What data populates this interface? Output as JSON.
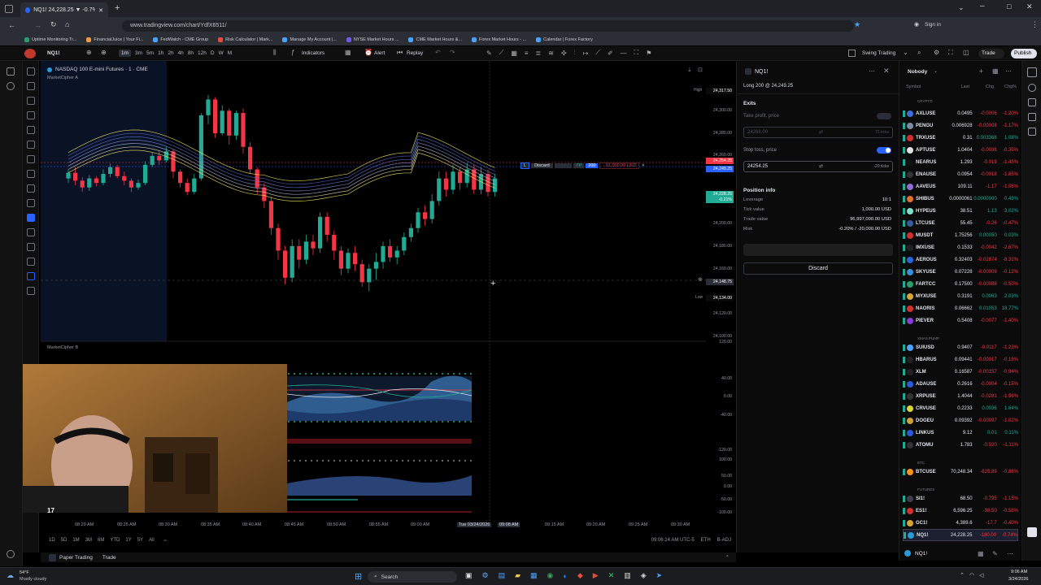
{
  "browser": {
    "tab_title": "NQ1! 24,228.25 ▼ -0.7% Swing...",
    "url": "www.tradingview.com/chart/YdfX6511/",
    "bookmarks": [
      "Uptime Monitoring Tr...",
      "FinancialJuice | Your Fi...",
      "FedWatch - CME Group",
      "Risk Calculator | Mark...",
      "Manage My Account |...",
      "NYSE Market Hours ...",
      "CME Market Hours &...",
      "Forex Market Hours - ...",
      "Calendar | Forex Factory"
    ],
    "sign_in": "Sign in"
  },
  "toolbar": {
    "symbol": "NQ1!",
    "timeframes": [
      "1m",
      "3m",
      "5m",
      "1h",
      "2h",
      "4h",
      "8h",
      "12h",
      "D",
      "W",
      "M"
    ],
    "indicators": "Indicators",
    "alert": "Alert",
    "replay": "Replay",
    "layout_name": "Swing Trading",
    "trade": "Trade",
    "publish": "Publish"
  },
  "chart": {
    "title": "NASDAQ 100 E-mini Futures · 1 · CME",
    "indicator_a": "MarketCipher A",
    "indicator_b": "MarketCipher B",
    "price_labels": [
      "24,317.50",
      "24,300.00",
      "24,280.00",
      "24,260.00",
      "24,254.25",
      "24,249.25",
      "24,228.25",
      "-0.21%",
      "24,200.00",
      "24,180.00",
      "24,160.00",
      "24,148.75",
      "24,134.00",
      "24,120.00",
      "24,100.00"
    ],
    "high_label": "High",
    "low_label": "Low",
    "order_discard": "Discard",
    "order_qty": "200",
    "order_tp": "TP",
    "order_sl_text": "- 91,000.00 USD",
    "osc_labels": [
      "120.00",
      "40.00",
      "0.00",
      "-40.00",
      "-120.00",
      "100.00",
      "50.00",
      "0.00",
      "-50.00",
      "-100.00"
    ],
    "time_labels": [
      "08:20 AM",
      "08:25 AM",
      "08:30 AM",
      "08:35 AM",
      "08:40 AM",
      "08:45 AM",
      "08:50 AM",
      "08:55 AM",
      "09:00 AM",
      "Tue 03/24/2026",
      "09:08 AM",
      "09:15 AM",
      "09:20 AM",
      "09:25 AM",
      "09:30 AM"
    ],
    "ranges": [
      "1D",
      "5D",
      "1M",
      "3M",
      "6M",
      "YTD",
      "1Y",
      "5Y",
      "All"
    ],
    "clock": "09:06:14 AM UTC-5",
    "session": "ETH",
    "adj": "B-ADJ"
  },
  "bottom_tabs": {
    "paper": "Paper Trading",
    "trade": "Trade"
  },
  "order_panel": {
    "symbol": "NQ1!",
    "position": "Long 200 @ 24,249.25",
    "exits": "Exits",
    "tp_label": "Take profit, price",
    "tp_value": "24268.00",
    "tp_ticks": "75 ticks",
    "sl_label": "Stop loss, price",
    "sl_value": "24254.25",
    "sl_ticks": "-20 ticks",
    "info_title": "Position info",
    "rows": [
      {
        "label": "Leverage",
        "value": "10:1"
      },
      {
        "label": "Tick value",
        "value": "1,000.00 USD"
      },
      {
        "label": "Trade value",
        "value": "96,997,000.00 USD"
      },
      {
        "label": "Risk",
        "value": "-0.20% / -20,000.00 USD"
      }
    ],
    "discard": "Discard"
  },
  "watchlist": {
    "title": "Nobody",
    "headers": {
      "symbol": "Symbol",
      "last": "Last",
      "chg": "Chg",
      "pct": "Chg%"
    },
    "sections": [
      "CRYPTO",
      "XMAS PUMP",
      "BTC",
      "FUTURES"
    ],
    "rows": [
      {
        "sym": "AXLUSE",
        "last": "0.0495",
        "chg": "-0.0006",
        "pct": "-1.20%",
        "c": "neg",
        "icon": "#3b6fd6"
      },
      {
        "sym": "PENGU",
        "last": "0.006928",
        "chg": "-0.00008",
        "pct": "-1.17%",
        "c": "neg",
        "icon": "#7a8ba3"
      },
      {
        "sym": "TRXUSE",
        "last": "0.31",
        "chg": "0.003366",
        "pct": "1.08%",
        "c": "pos",
        "icon": "#d23030"
      },
      {
        "sym": "APTUSE",
        "last": "1.0404",
        "chg": "-0.0036",
        "pct": "-0.35%",
        "c": "neg",
        "icon": "#e0e0e0"
      },
      {
        "sym": "NEARUS",
        "last": "1.293",
        "chg": "-0.019",
        "pct": "-1.45%",
        "c": "neg",
        "icon": "#111"
      },
      {
        "sym": "ENAUSE",
        "last": "0.0954",
        "chg": "-0.0018",
        "pct": "-1.85%",
        "c": "neg",
        "icon": "#333"
      },
      {
        "sym": "AAVEUS",
        "last": "109.11",
        "chg": "-1.17",
        "pct": "-1.06%",
        "c": "neg",
        "icon": "#8e6bd6"
      },
      {
        "sym": "SHIBUS",
        "last": "0.0000061",
        "chg": "0.0000000",
        "pct": "0.49%",
        "c": "pos",
        "icon": "#e0702a"
      },
      {
        "sym": "HYPEUS",
        "last": "38.51",
        "chg": "1.13",
        "pct": "3.02%",
        "c": "pos",
        "icon": "#7ee0c8"
      },
      {
        "sym": "LTCUSE",
        "last": "55.45",
        "chg": "-0.26",
        "pct": "-0.47%",
        "c": "neg",
        "icon": "#345d9d"
      },
      {
        "sym": "MUSDT",
        "last": "1.75256",
        "chg": "0.00050",
        "pct": "0.03%",
        "c": "pos",
        "icon": "#d23030"
      },
      {
        "sym": "IMXUSE",
        "last": "0.1533",
        "chg": "-0.0042",
        "pct": "-2.67%",
        "c": "neg",
        "icon": "#222"
      },
      {
        "sym": "AEROUS",
        "last": "0.32403",
        "chg": "-0.02874",
        "pct": "-8.31%",
        "c": "neg",
        "icon": "#2d64e0"
      },
      {
        "sym": "SKYUSE",
        "last": "0.07228",
        "chg": "-0.00009",
        "pct": "-0.12%",
        "c": "neg",
        "icon": "#3a8fd6"
      },
      {
        "sym": "FARTCC",
        "last": "0.17500",
        "chg": "-0.00088",
        "pct": "-0.50%",
        "c": "neg",
        "icon": "#2a9d6b"
      },
      {
        "sym": "MYXUSE",
        "last": "0.3191",
        "chg": "0.0063",
        "pct": "2.03%",
        "c": "pos",
        "icon": "#d6a53a"
      },
      {
        "sym": "NAORIS",
        "last": "0.06662",
        "chg": "0.01053",
        "pct": "18.77%",
        "c": "pos",
        "icon": "#d23030"
      },
      {
        "sym": "PIEVER",
        "last": "0.5408",
        "chg": "-0.0077",
        "pct": "-1.40%",
        "c": "neg",
        "icon": "#8a3ad6"
      },
      {
        "sym": "SUIUSD",
        "last": "0.9407",
        "chg": "-0.0117",
        "pct": "-1.23%",
        "c": "neg",
        "icon": "#4da2ff"
      },
      {
        "sym": "HBARUS",
        "last": "0.09441",
        "chg": "-0.00017",
        "pct": "-0.18%",
        "c": "neg",
        "icon": "#222"
      },
      {
        "sym": "XLM",
        "last": "0.16587",
        "chg": "-0.00157",
        "pct": "-0.94%",
        "c": "neg",
        "icon": "#222"
      },
      {
        "sym": "ADAUSE",
        "last": "0.2616",
        "chg": "-0.0004",
        "pct": "-0.15%",
        "c": "neg",
        "icon": "#2a5ad6"
      },
      {
        "sym": "XRPUSE",
        "last": "1.4044",
        "chg": "-0.0281",
        "pct": "-1.96%",
        "c": "neg",
        "icon": "#333"
      },
      {
        "sym": "CRVUSE",
        "last": "0.2233",
        "chg": "0.0036",
        "pct": "1.64%",
        "c": "pos",
        "icon": "#d6d63a"
      },
      {
        "sym": "DOGEU",
        "last": "0.09392",
        "chg": "-0.00097",
        "pct": "-1.02%",
        "c": "neg",
        "icon": "#c9a43a"
      },
      {
        "sym": "LINKUS",
        "last": "9.12",
        "chg": "0.01",
        "pct": "0.11%",
        "c": "pos",
        "icon": "#2a5ad6"
      },
      {
        "sym": "ATOMU",
        "last": "1.783",
        "chg": "-0.020",
        "pct": "-1.11%",
        "c": "neg",
        "icon": "#333"
      },
      {
        "sym": "BTCUSE",
        "last": "70,248.34",
        "chg": "-625.89",
        "pct": "-0.88%",
        "c": "neg",
        "icon": "#f7931a"
      },
      {
        "sym": "SI1!",
        "last": "68.50",
        "chg": "-0.795",
        "pct": "-1.15%",
        "c": "neg",
        "icon": "#3a3f4b"
      },
      {
        "sym": "ES1!",
        "last": "6,596.25",
        "chg": "-38.50",
        "pct": "-0.58%",
        "c": "neg",
        "icon": "#d23030"
      },
      {
        "sym": "GC1!",
        "last": "4,389.6",
        "chg": "-17.7",
        "pct": "-0.40%",
        "c": "neg",
        "icon": "#d6a53a"
      },
      {
        "sym": "NQ1!",
        "last": "24,228.25",
        "chg": "-180.00",
        "pct": "-0.74%",
        "c": "neg",
        "icon": "#2a9bd6"
      }
    ],
    "footer_symbol": "NQ1!"
  },
  "taskbar": {
    "weather_temp": "54°F",
    "weather_desc": "Mostly cloudy",
    "search": "Search",
    "time": "9:06 AM",
    "date": "3/24/2026"
  }
}
